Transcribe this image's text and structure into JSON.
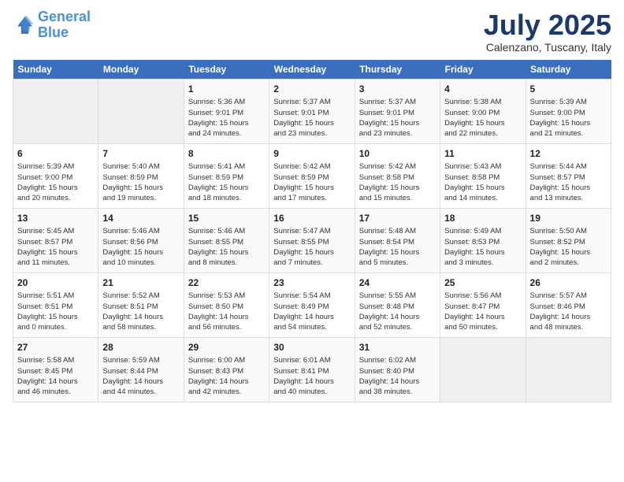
{
  "logo": {
    "line1": "General",
    "line2": "Blue"
  },
  "title": "July 2025",
  "subtitle": "Calenzano, Tuscany, Italy",
  "header_days": [
    "Sunday",
    "Monday",
    "Tuesday",
    "Wednesday",
    "Thursday",
    "Friday",
    "Saturday"
  ],
  "weeks": [
    [
      {
        "day": "",
        "info": ""
      },
      {
        "day": "",
        "info": ""
      },
      {
        "day": "1",
        "info": "Sunrise: 5:36 AM\nSunset: 9:01 PM\nDaylight: 15 hours\nand 24 minutes."
      },
      {
        "day": "2",
        "info": "Sunrise: 5:37 AM\nSunset: 9:01 PM\nDaylight: 15 hours\nand 23 minutes."
      },
      {
        "day": "3",
        "info": "Sunrise: 5:37 AM\nSunset: 9:01 PM\nDaylight: 15 hours\nand 23 minutes."
      },
      {
        "day": "4",
        "info": "Sunrise: 5:38 AM\nSunset: 9:00 PM\nDaylight: 15 hours\nand 22 minutes."
      },
      {
        "day": "5",
        "info": "Sunrise: 5:39 AM\nSunset: 9:00 PM\nDaylight: 15 hours\nand 21 minutes."
      }
    ],
    [
      {
        "day": "6",
        "info": "Sunrise: 5:39 AM\nSunset: 9:00 PM\nDaylight: 15 hours\nand 20 minutes."
      },
      {
        "day": "7",
        "info": "Sunrise: 5:40 AM\nSunset: 8:59 PM\nDaylight: 15 hours\nand 19 minutes."
      },
      {
        "day": "8",
        "info": "Sunrise: 5:41 AM\nSunset: 8:59 PM\nDaylight: 15 hours\nand 18 minutes."
      },
      {
        "day": "9",
        "info": "Sunrise: 5:42 AM\nSunset: 8:59 PM\nDaylight: 15 hours\nand 17 minutes."
      },
      {
        "day": "10",
        "info": "Sunrise: 5:42 AM\nSunset: 8:58 PM\nDaylight: 15 hours\nand 15 minutes."
      },
      {
        "day": "11",
        "info": "Sunrise: 5:43 AM\nSunset: 8:58 PM\nDaylight: 15 hours\nand 14 minutes."
      },
      {
        "day": "12",
        "info": "Sunrise: 5:44 AM\nSunset: 8:57 PM\nDaylight: 15 hours\nand 13 minutes."
      }
    ],
    [
      {
        "day": "13",
        "info": "Sunrise: 5:45 AM\nSunset: 8:57 PM\nDaylight: 15 hours\nand 11 minutes."
      },
      {
        "day": "14",
        "info": "Sunrise: 5:46 AM\nSunset: 8:56 PM\nDaylight: 15 hours\nand 10 minutes."
      },
      {
        "day": "15",
        "info": "Sunrise: 5:46 AM\nSunset: 8:55 PM\nDaylight: 15 hours\nand 8 minutes."
      },
      {
        "day": "16",
        "info": "Sunrise: 5:47 AM\nSunset: 8:55 PM\nDaylight: 15 hours\nand 7 minutes."
      },
      {
        "day": "17",
        "info": "Sunrise: 5:48 AM\nSunset: 8:54 PM\nDaylight: 15 hours\nand 5 minutes."
      },
      {
        "day": "18",
        "info": "Sunrise: 5:49 AM\nSunset: 8:53 PM\nDaylight: 15 hours\nand 3 minutes."
      },
      {
        "day": "19",
        "info": "Sunrise: 5:50 AM\nSunset: 8:52 PM\nDaylight: 15 hours\nand 2 minutes."
      }
    ],
    [
      {
        "day": "20",
        "info": "Sunrise: 5:51 AM\nSunset: 8:51 PM\nDaylight: 15 hours\nand 0 minutes."
      },
      {
        "day": "21",
        "info": "Sunrise: 5:52 AM\nSunset: 8:51 PM\nDaylight: 14 hours\nand 58 minutes."
      },
      {
        "day": "22",
        "info": "Sunrise: 5:53 AM\nSunset: 8:50 PM\nDaylight: 14 hours\nand 56 minutes."
      },
      {
        "day": "23",
        "info": "Sunrise: 5:54 AM\nSunset: 8:49 PM\nDaylight: 14 hours\nand 54 minutes."
      },
      {
        "day": "24",
        "info": "Sunrise: 5:55 AM\nSunset: 8:48 PM\nDaylight: 14 hours\nand 52 minutes."
      },
      {
        "day": "25",
        "info": "Sunrise: 5:56 AM\nSunset: 8:47 PM\nDaylight: 14 hours\nand 50 minutes."
      },
      {
        "day": "26",
        "info": "Sunrise: 5:57 AM\nSunset: 8:46 PM\nDaylight: 14 hours\nand 48 minutes."
      }
    ],
    [
      {
        "day": "27",
        "info": "Sunrise: 5:58 AM\nSunset: 8:45 PM\nDaylight: 14 hours\nand 46 minutes."
      },
      {
        "day": "28",
        "info": "Sunrise: 5:59 AM\nSunset: 8:44 PM\nDaylight: 14 hours\nand 44 minutes."
      },
      {
        "day": "29",
        "info": "Sunrise: 6:00 AM\nSunset: 8:43 PM\nDaylight: 14 hours\nand 42 minutes."
      },
      {
        "day": "30",
        "info": "Sunrise: 6:01 AM\nSunset: 8:41 PM\nDaylight: 14 hours\nand 40 minutes."
      },
      {
        "day": "31",
        "info": "Sunrise: 6:02 AM\nSunset: 8:40 PM\nDaylight: 14 hours\nand 38 minutes."
      },
      {
        "day": "",
        "info": ""
      },
      {
        "day": "",
        "info": ""
      }
    ]
  ]
}
